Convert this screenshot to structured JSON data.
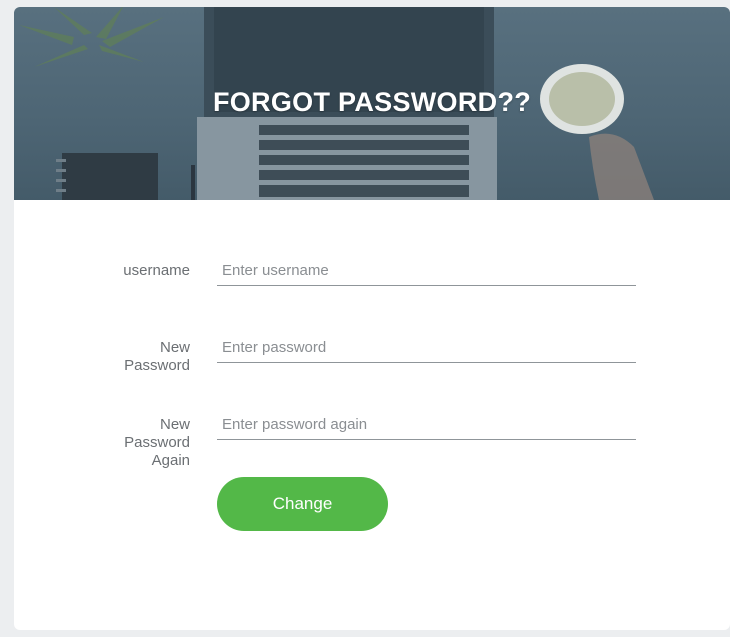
{
  "header": {
    "title": "FORGOT PASSWORD??"
  },
  "form": {
    "username": {
      "label": "username",
      "placeholder": "Enter username",
      "value": ""
    },
    "new_password": {
      "label_lines": [
        "New",
        "Password"
      ],
      "placeholder": "Enter password",
      "value": ""
    },
    "new_password_again": {
      "label_lines": [
        "New",
        "Password",
        "Again"
      ],
      "placeholder": "Enter password again",
      "value": ""
    },
    "submit_label": "Change"
  },
  "colors": {
    "accent": "#53b848",
    "header_overlay": "#4d6574"
  },
  "icons": {
    "header_image": "laptop-desk-photo"
  }
}
